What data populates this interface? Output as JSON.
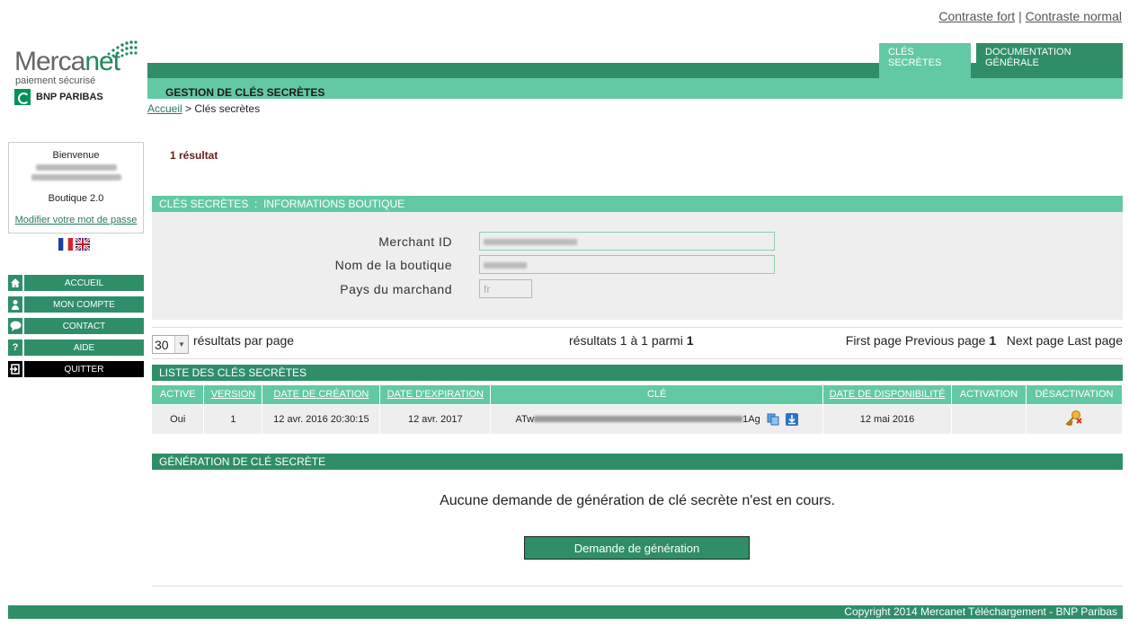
{
  "header": {
    "contrast_high": "Contraste fort",
    "contrast_sep": "|",
    "contrast_normal": "Contraste normal",
    "tabs": [
      {
        "label": "CLÉS SECRÈTES"
      },
      {
        "label": "DOCUMENTATION GÉNÉRALE"
      }
    ],
    "section_title": "GESTION DE CLÉS SECRÈTES"
  },
  "logo": {
    "word_a": "Merca",
    "word_b": "net",
    "tagline": "paiement sécurisé",
    "bank": "BNP PARIBAS"
  },
  "breadcrumb": {
    "home": "Accueil",
    "sep": " > ",
    "current": "Clés secrètes"
  },
  "sidebar": {
    "welcome": "Bienvenue",
    "shop": "Boutique 2.0",
    "change_password": "Modifier votre mot de passe",
    "items": [
      {
        "label": "ACCUEIL",
        "icon": "home-icon"
      },
      {
        "label": "MON COMPTE",
        "icon": "user-icon"
      },
      {
        "label": "CONTACT",
        "icon": "speech-bubble-icon"
      },
      {
        "label": "AIDE",
        "icon": "question-icon"
      },
      {
        "label": "QUITTER",
        "icon": "exit-icon"
      }
    ]
  },
  "main": {
    "result_count": "1 résultat",
    "info_section": "CLÉS SECRÈTES  :  INFORMATIONS BOUTIQUE",
    "fields": {
      "merchant_id_label": "Merchant ID",
      "shop_name_label": "Nom de la boutique",
      "country_label": "Pays du marchand",
      "country_value": "fr"
    },
    "pager": {
      "per_page_value": "30",
      "per_page_label": "résultats par page",
      "range_text": "résultats 1 à 1 parmi ",
      "range_total": "1",
      "first": "First page",
      "previous": "Previous page",
      "current": "1",
      "next": "Next page",
      "last": "Last page"
    },
    "list_section": "LISTE DES CLÉS SECRÈTES",
    "table": {
      "columns": [
        "ACTIVE",
        "VERSION",
        "DATE DE CRÉATION",
        "DATE D'EXPIRATION",
        "CLÉ",
        "DATE DE DISPONIBILITÉ",
        "ACTIVATION",
        "DÉSACTIVATION"
      ],
      "rows": [
        {
          "active": "Oui",
          "version": "1",
          "created": "12 avr. 2016 20:30:15",
          "expires": "12 avr. 2017",
          "key_start": "ATw",
          "key_end": "1Ag",
          "available": "12 mai 2016"
        }
      ]
    },
    "gen_section": "GÉNÉRATION DE CLÉ SECRÈTE",
    "gen_text": "Aucune demande de génération de clé secrète n'est en cours.",
    "gen_button": "Demande de génération"
  },
  "footer": {
    "copyright": "Copyright 2014 Mercanet Téléchargement - BNP Paribas"
  },
  "colors": {
    "dark_green": "#2f8e68",
    "light_green": "#63c9a2",
    "panel_grey": "#eeeeee"
  }
}
